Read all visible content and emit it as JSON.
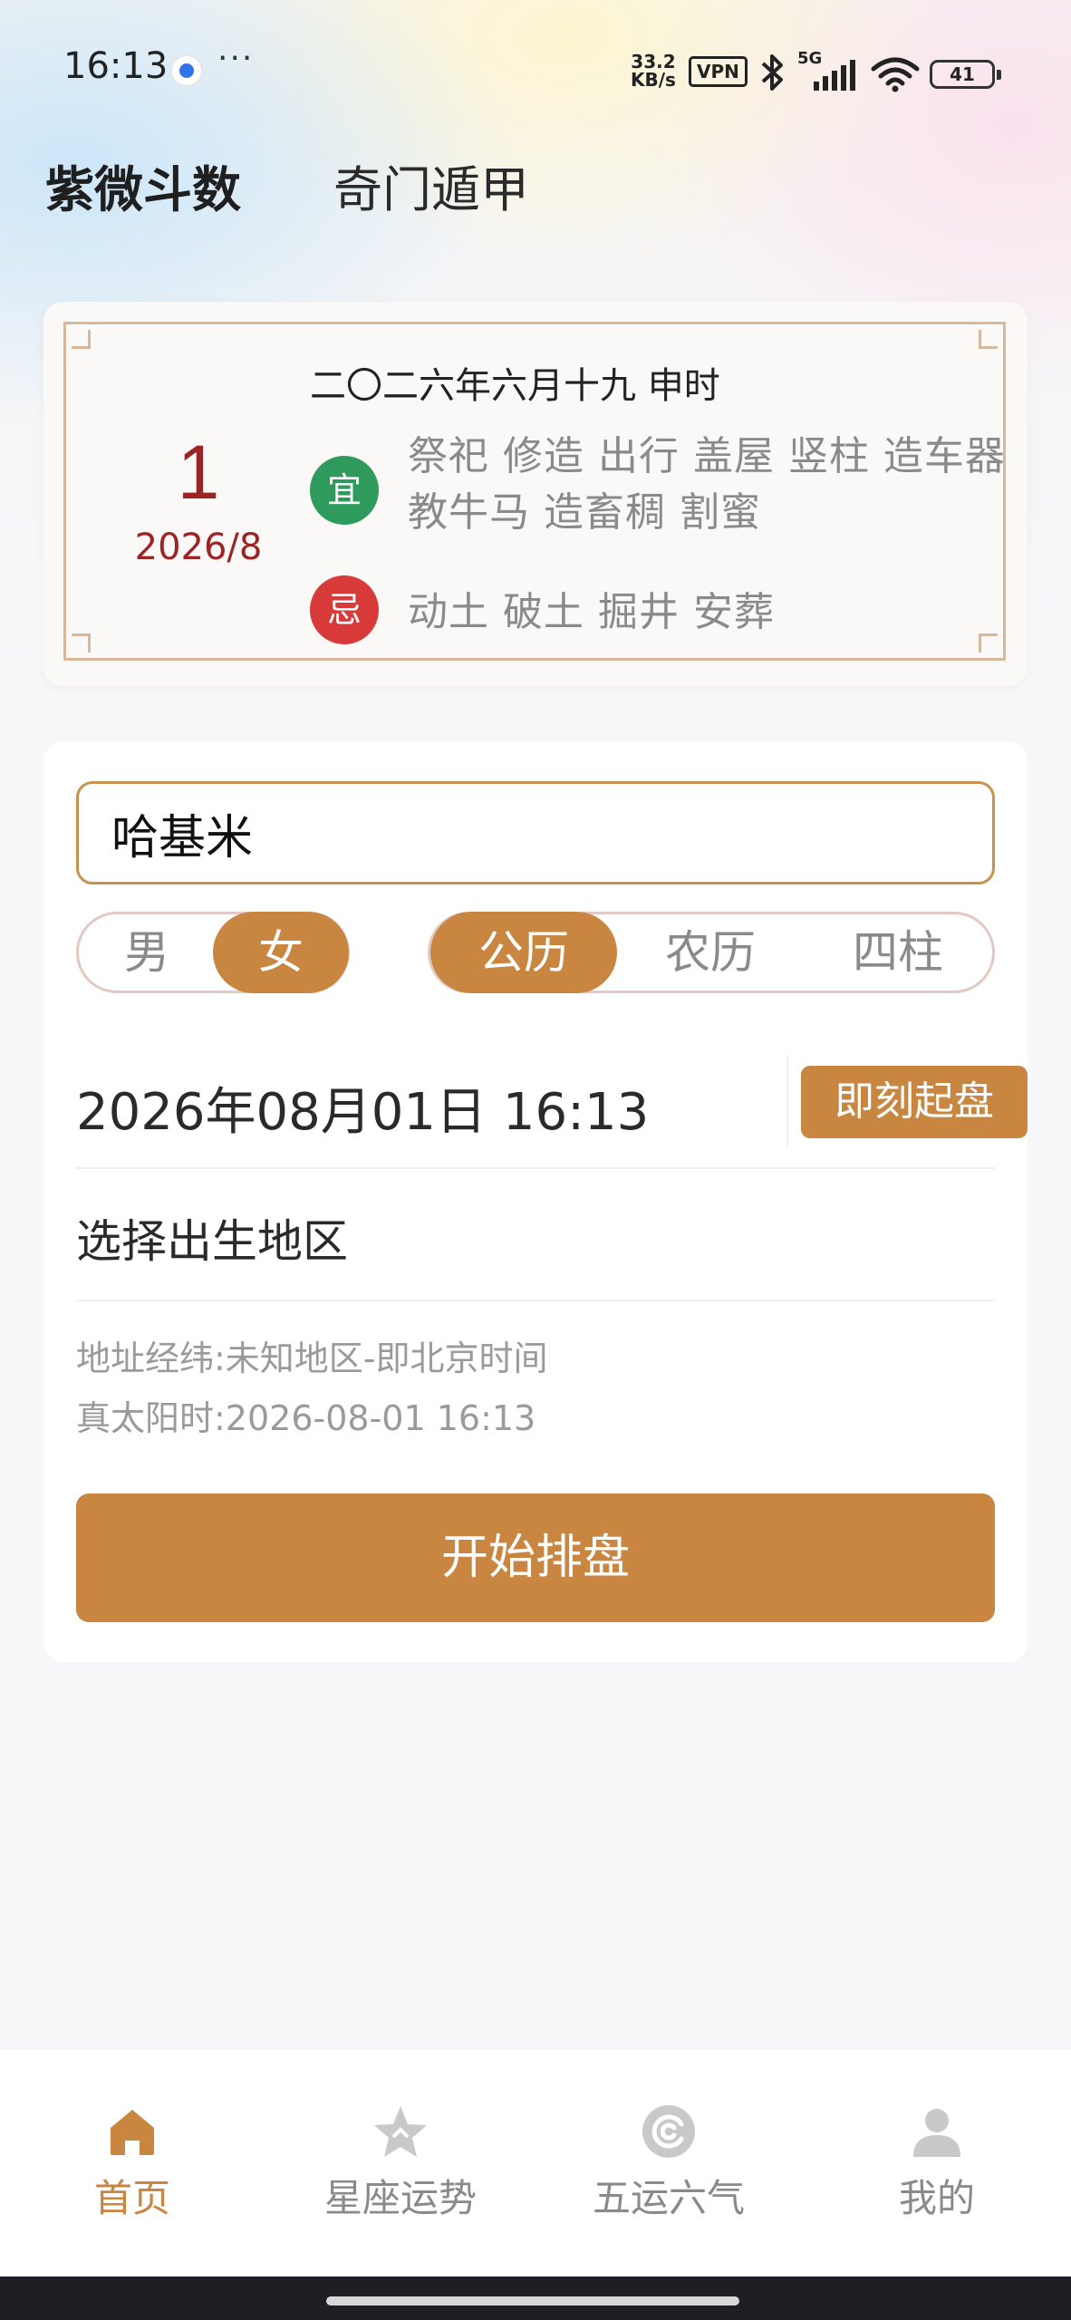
{
  "status_bar": {
    "time": "16:13",
    "more": "···",
    "speed_top": "33.2",
    "speed_bottom": "KB/s",
    "vpn": "VPN",
    "signal_label": "5G",
    "battery": "41"
  },
  "top_tabs": {
    "active": "紫微斗数",
    "inactive": "奇门遁甲"
  },
  "almanac": {
    "day": "1",
    "year_month": "2026/8",
    "lunar_date": "二〇二六年六月十九 申时",
    "yi_badge": "宜",
    "yi_text": "祭祀 修造 出行 盖屋 竖柱 造车器 教牛马 造畜稠 割蜜",
    "ji_badge": "忌",
    "ji_text": "动土 破土 掘井 安葬"
  },
  "form": {
    "name_value": "哈基米",
    "gender": {
      "male": "男",
      "female": "女",
      "selected": "female"
    },
    "calendar": {
      "solar": "公历",
      "lunar": "农历",
      "pillars": "四柱",
      "selected": "solar"
    },
    "datetime": "2026年08月01日 16:13",
    "now_button": "即刻起盘",
    "region_label": "选择出生地区",
    "address_line": "地址经纬:未知地区-即北京时间",
    "solar_time_line": "真太阳时:2026-08-01 16:13",
    "start_button": "开始排盘"
  },
  "bottom_nav": {
    "items": [
      {
        "label": "首页",
        "icon": "home-icon",
        "active": true
      },
      {
        "label": "星座运势",
        "icon": "star-icon",
        "active": false
      },
      {
        "label": "五运六气",
        "icon": "swirl-icon",
        "active": false
      },
      {
        "label": "我的",
        "icon": "person-icon",
        "active": false
      }
    ]
  },
  "colors": {
    "accent": "#c98640",
    "yi_green": "#2e9a5b",
    "ji_red": "#d83a3a",
    "date_red": "#9b2424"
  }
}
